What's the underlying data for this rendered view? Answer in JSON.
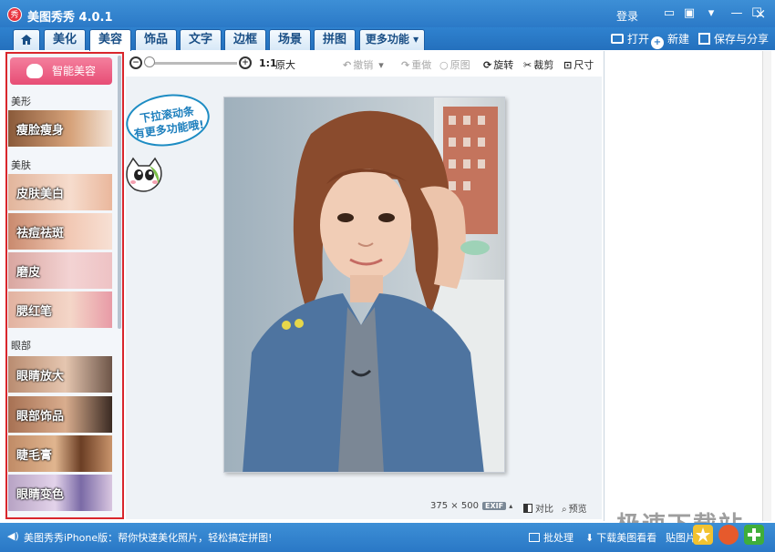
{
  "window": {
    "title": "美图秀秀 4.0.1",
    "login": "登录",
    "logo_char": "秀"
  },
  "tabs": [
    {
      "label": "美化"
    },
    {
      "label": "美容"
    },
    {
      "label": "饰品"
    },
    {
      "label": "文字"
    },
    {
      "label": "边框"
    },
    {
      "label": "场景"
    },
    {
      "label": "拼图"
    },
    {
      "label": "更多功能 ▾"
    }
  ],
  "header_tools": {
    "open": "打开",
    "new": "新建",
    "save_share": "保存与分享"
  },
  "left_panel": {
    "smart_button": "智能美容",
    "sections": [
      {
        "label": "美形",
        "items": [
          "瘦脸瘦身"
        ]
      },
      {
        "label": "美肤",
        "items": [
          "皮肤美白",
          "祛痘祛斑",
          "磨皮",
          "腮红笔"
        ]
      },
      {
        "label": "眼部",
        "items": [
          "眼睛放大",
          "眼部饰品",
          "睫毛膏",
          "眼睛变色"
        ]
      }
    ]
  },
  "toolbar": {
    "ratio": "1:1",
    "original_size": "原大",
    "undo": "撤销",
    "redo": "重做",
    "original": "原图",
    "rotate": "旋转",
    "crop": "裁剪",
    "size": "尺寸"
  },
  "canvas": {
    "image_width": "375",
    "image_height": "500",
    "size_separator": "×",
    "exif_badge": "EXIF",
    "compare": "对比",
    "preview": "预览"
  },
  "tip_bubble": {
    "line1": "下拉滚动条",
    "line2": "有更多功能哦!"
  },
  "statusbar": {
    "message": "美图秀秀iPhone版：帮你快速美化照片，轻松搞定拼图!",
    "batch": "批处理",
    "download": "下载美图看看",
    "sticker": "贴图片"
  },
  "watermark": "极速下载站",
  "colors": {
    "title_blue": "#2a78c6",
    "tab_active": "#ffffff",
    "panel_border": "#d9262c",
    "smart_pink": "#e74d75"
  }
}
